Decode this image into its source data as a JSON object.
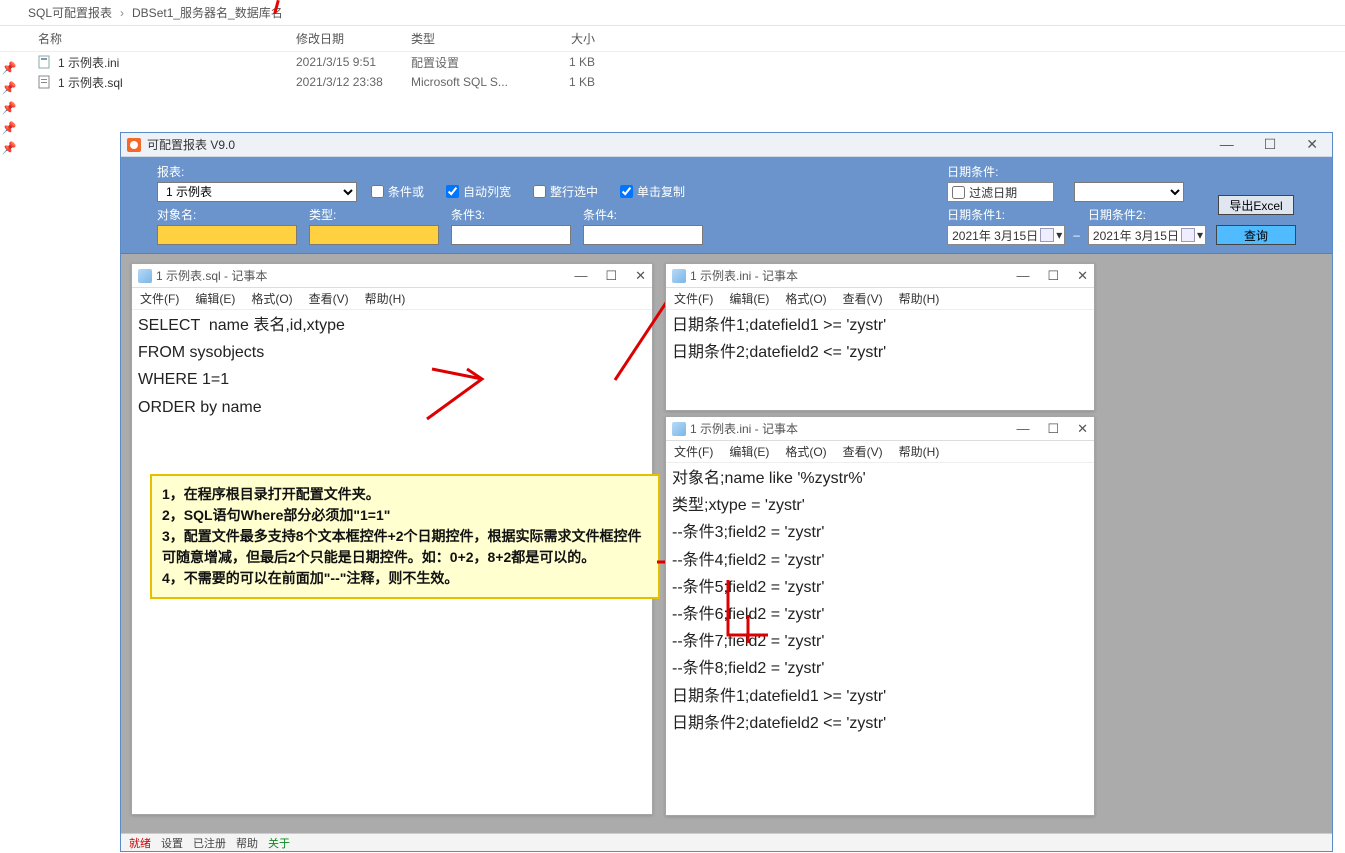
{
  "breadcrumb": {
    "p1": "SQL可配置报表",
    "p2": "DBSet1_服务器名_数据库名"
  },
  "columns": {
    "name": "名称",
    "date": "修改日期",
    "type": "类型",
    "size": "大小"
  },
  "files": [
    {
      "name": "1 示例表.ini",
      "date": "2021/3/15 9:51",
      "type": "配置设置",
      "size": "1 KB"
    },
    {
      "name": "1 示例表.sql",
      "date": "2021/3/12 23:38",
      "type": "Microsoft SQL S...",
      "size": "1 KB"
    }
  ],
  "app": {
    "title": "可配置报表 V9.0",
    "labels": {
      "report": "报表:",
      "obj": "对象名:",
      "type": "类型:",
      "c3": "条件3:",
      "c4": "条件4:",
      "datecond": "日期条件:",
      "filter": "过滤日期",
      "dc1": "日期条件1:",
      "dc2": "日期条件2:"
    },
    "report_value": "1 示例表",
    "checks": {
      "or": "条件或",
      "autow": "自动列宽",
      "wholerow": "整行选中",
      "singlecopy": "单击复制"
    },
    "date_value": "2021年 3月15日",
    "btn_export": "导出Excel",
    "btn_query": "查询"
  },
  "notepad_menu": [
    "文件(F)",
    "编辑(E)",
    "格式(O)",
    "查看(V)",
    "帮助(H)"
  ],
  "np1": {
    "title": "1 示例表.sql - 记事本",
    "body": "SELECT  name 表名,id,xtype\nFROM sysobjects\nWHERE 1=1\nORDER by name"
  },
  "np2": {
    "title": "1 示例表.ini - 记事本",
    "body": "日期条件1;datefield1 >= 'zystr'\n日期条件2;datefield2 <= 'zystr'"
  },
  "np3": {
    "title": "1 示例表.ini - 记事本",
    "body": "对象名;name like '%zystr%'\n类型;xtype = 'zystr'\n--条件3;field2 = 'zystr'\n--条件4;field2 = 'zystr'\n--条件5;field2 = 'zystr'\n--条件6;field2 = 'zystr'\n--条件7;field2 = 'zystr'\n--条件8;field2 = 'zystr'\n日期条件1;datefield1 >= 'zystr'\n日期条件2;datefield2 <= 'zystr'"
  },
  "note": "1，在程序根目录打开配置文件夹。\n2，SQL语句Where部分必须加\"1=1\"\n3，配置文件最多支持8个文本框控件+2个日期控件，根据实际需求文件框控件可随意增减，但最后2个只能是日期控件。如：0+2，8+2都是可以的。\n4，不需要的可以在前面加\"--\"注释，则不生效。",
  "status": {
    "ready": "就绪",
    "settings": "设置",
    "reg": "已注册",
    "help": "帮助",
    "about": "关于"
  }
}
